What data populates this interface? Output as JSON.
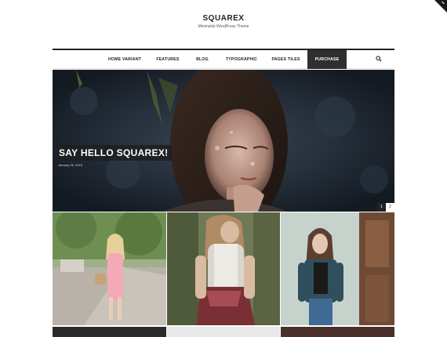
{
  "site": {
    "title": "SQUAREX",
    "tagline": "Minimalist WordPress Theme"
  },
  "nav": {
    "items": [
      {
        "label": "HOME VARIANT"
      },
      {
        "label": "FEATURES"
      },
      {
        "label": "BLOG"
      },
      {
        "label": "TYPOGRAPHIC"
      },
      {
        "label": "PAGES TILES"
      },
      {
        "label": "PURCHASE"
      }
    ],
    "active": "PURCHASE",
    "search_icon": "search-icon"
  },
  "hero": {
    "title": "SAY HELLO SQUAREX!",
    "date": "January 26, 2015",
    "slider_pages": [
      "1",
      "2"
    ],
    "active_page": "1"
  },
  "colors": {
    "nav_active_bg": "#2f2f2f",
    "text": "#222222",
    "corner_badge": "#1a1a1a"
  }
}
